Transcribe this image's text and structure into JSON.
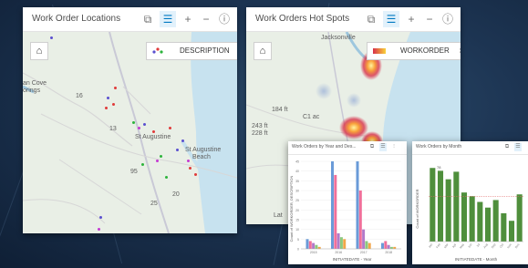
{
  "panels": {
    "locations": {
      "title": "Work Order Locations",
      "toolbar_icons": [
        "copy-icon",
        "list-icon",
        "zoom-in-icon",
        "zoom-out-icon",
        "info-icon"
      ],
      "legend_label": "DESCRIPTION",
      "place_labels": {
        "pan_cove": "an Cove",
        "orings": "orings",
        "st_augustine": "St Augustine",
        "st_augustine_beach_1": "St Augustine",
        "st_augustine_beach_2": "Beach",
        "route_16": "16",
        "route_13": "13",
        "route_95": "95",
        "route_20": "20",
        "route_25": "25"
      }
    },
    "hotspots": {
      "title": "Work Orders Hot Spots",
      "toolbar_icons": [
        "copy-icon",
        "list-icon",
        "zoom-in-icon",
        "zoom-out-icon",
        "info-icon"
      ],
      "legend_label": "WORKORDER",
      "place_labels": {
        "jacksonville": "Jacksonville",
        "r184": "184 ft",
        "r243": "243 ft",
        "r228": "228 ft",
        "c1": "C1 ac",
        "bottom": "Lat"
      }
    }
  },
  "charts": {
    "by_year": {
      "title": "Work Orders by Year and Des...",
      "xlabel": "INITIATEDATE - Year",
      "ylabel": "Count of WORKORDER, DESCRIPTION",
      "x_ticks": [
        "2015",
        "2016",
        "2017",
        "2018"
      ],
      "y_ticks": [
        "0",
        "5",
        "10",
        "15",
        "20",
        "25",
        "30",
        "35",
        "40",
        "45"
      ]
    },
    "by_month": {
      "title": "Work Orders by Month",
      "xlabel": "INITIATEDATE - Month",
      "ylabel": "Count of WORKORDER",
      "top_value": "78"
    }
  },
  "chart_data": [
    {
      "type": "bar",
      "title": "Work Orders by Year and Des...",
      "xlabel": "INITIATEDATE - Year",
      "ylabel": "Count of WORKORDER, DESCRIPTION",
      "categories": [
        "2015",
        "2016",
        "2017",
        "2018"
      ],
      "ylim": [
        0,
        45
      ],
      "series": [
        {
          "color": "#6a9bd8",
          "values": [
            5,
            45,
            45,
            3
          ]
        },
        {
          "color": "#f06f9a",
          "values": [
            4,
            38,
            30,
            4
          ]
        },
        {
          "color": "#b27ac9",
          "values": [
            3,
            8,
            10,
            2
          ]
        },
        {
          "color": "#8cc97e",
          "values": [
            2,
            6,
            4,
            1
          ]
        },
        {
          "color": "#f2a649",
          "values": [
            1,
            5,
            3,
            1
          ]
        }
      ]
    },
    {
      "type": "bar",
      "title": "Work Orders by Month",
      "xlabel": "INITIATEDATE - Month",
      "ylabel": "Count of WORKORDER",
      "categories": [
        "Jan",
        "Feb",
        "Mar",
        "Apr",
        "May",
        "Jun",
        "Jul",
        "Aug",
        "Sep",
        "Oct",
        "Nov",
        "Dec"
      ],
      "values": [
        78,
        75,
        66,
        74,
        52,
        48,
        42,
        36,
        44,
        30,
        22,
        50
      ],
      "ylim": [
        0,
        85
      ],
      "color": "#4f8f3c",
      "threshold_line": 48
    }
  ]
}
